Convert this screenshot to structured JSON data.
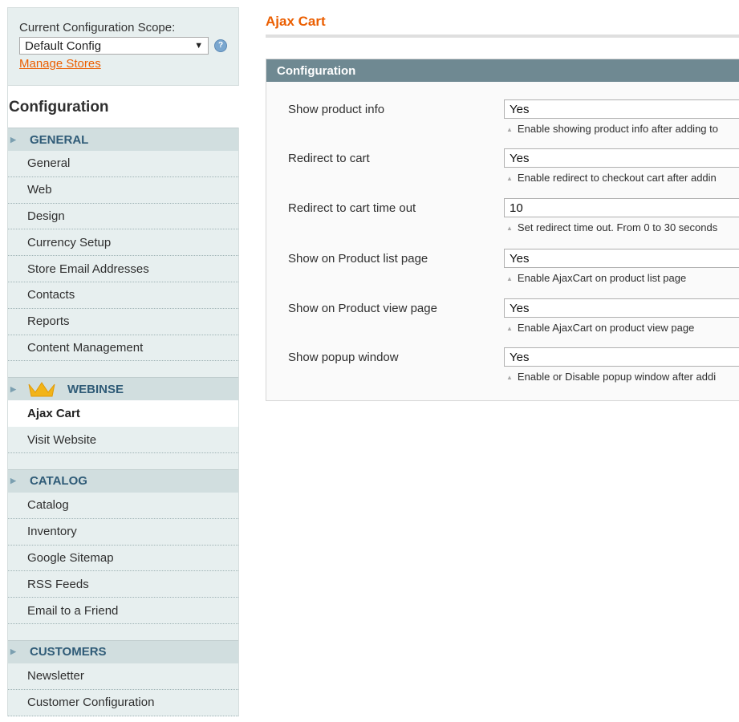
{
  "scope": {
    "label": "Current Configuration Scope:",
    "selected": "Default Config",
    "help_icon": "help-icon",
    "manage_link": "Manage Stores"
  },
  "sidebar": {
    "title": "Configuration",
    "sections": [
      {
        "name": "GENERAL",
        "items": [
          "General",
          "Web",
          "Design",
          "Currency Setup",
          "Store Email Addresses",
          "Contacts",
          "Reports",
          "Content Management"
        ]
      },
      {
        "name": "WEBINSE",
        "icon": "crown-icon",
        "items": [
          "Ajax Cart",
          "Visit Website"
        ],
        "active": "Ajax Cart"
      },
      {
        "name": "CATALOG",
        "items": [
          "Catalog",
          "Inventory",
          "Google Sitemap",
          "RSS Feeds",
          "Email to a Friend"
        ]
      },
      {
        "name": "CUSTOMERS",
        "items": [
          "Newsletter",
          "Customer Configuration"
        ]
      }
    ]
  },
  "main": {
    "title": "Ajax Cart",
    "fieldset_title": "Configuration",
    "rows": [
      {
        "label": "Show product info",
        "value": "Yes",
        "note": "Enable showing product info after adding to"
      },
      {
        "label": "Redirect to cart",
        "value": "Yes",
        "note": "Enable redirect to checkout cart after addin"
      },
      {
        "label": "Redirect to cart time out",
        "value": "10",
        "note": "Set redirect time out. From 0 to 30 seconds"
      },
      {
        "label": "Show on Product list page",
        "value": "Yes",
        "note": "Enable AjaxCart on product list page"
      },
      {
        "label": "Show on Product view page",
        "value": "Yes",
        "note": "Enable AjaxCart on product view page"
      },
      {
        "label": "Show popup window",
        "value": "Yes",
        "note": "Enable or Disable popup window after addi"
      }
    ]
  },
  "colors": {
    "accent": "#eb5e00",
    "sidebar_bg": "#e7efef",
    "section_header_bg": "#d1dedf",
    "fieldset_header_bg": "#6f8992"
  }
}
